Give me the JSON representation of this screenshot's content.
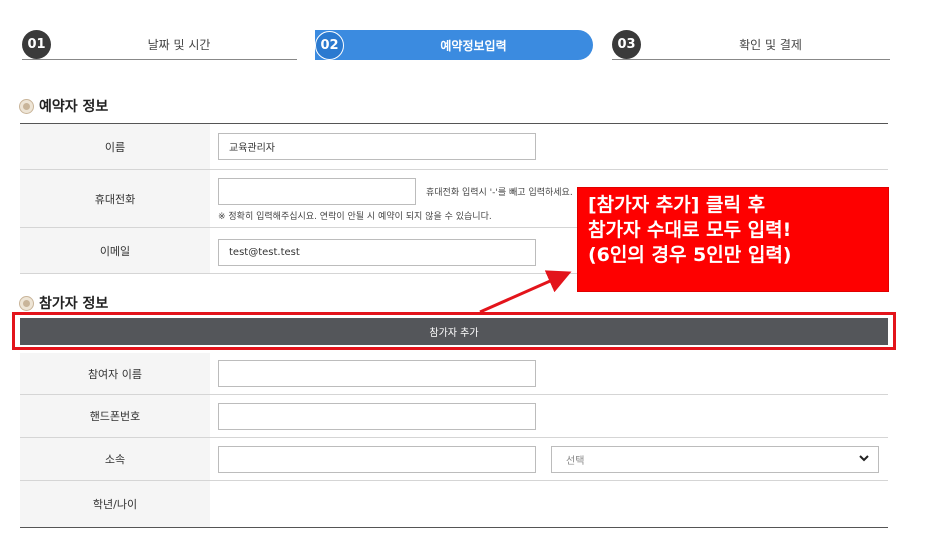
{
  "steps": [
    {
      "num": "01",
      "label": "날짜 및 시간"
    },
    {
      "num": "02",
      "label": "예약정보입력"
    },
    {
      "num": "03",
      "label": "확인 및 결제"
    }
  ],
  "reserver_section": {
    "title": "예약자 정보",
    "name_label": "이름",
    "name_value": "교육관리자",
    "phone_label": "휴대전화",
    "phone_value": "",
    "phone_hint": "휴대전화 입력시 '-'를 빼고 입력하세요.",
    "phone_notice": "※ 정확히 입력해주십시요. 연락이 안될 시 예약이 되지 않을 수 있습니다.",
    "email_label": "이메일",
    "email_value": "test@test.test"
  },
  "participant_section": {
    "title": "참가자 정보",
    "add_button": "참가자 추가",
    "name_label": "참여자 이름",
    "phone_label": "핸드폰번호",
    "org_label": "소속",
    "org_select": "선택",
    "grade_label": "학년/나이"
  },
  "callout": {
    "line1": "[참가자 추가] 클릭 후",
    "line2": "참가자 수대로 모두 입력!",
    "line3": "(6인의 경우 5인만 입력)"
  },
  "colors": {
    "active_step": "#3b8be0",
    "button_bg": "#54565a",
    "highlight": "#e3141b",
    "callout_bg": "#fe0000"
  }
}
